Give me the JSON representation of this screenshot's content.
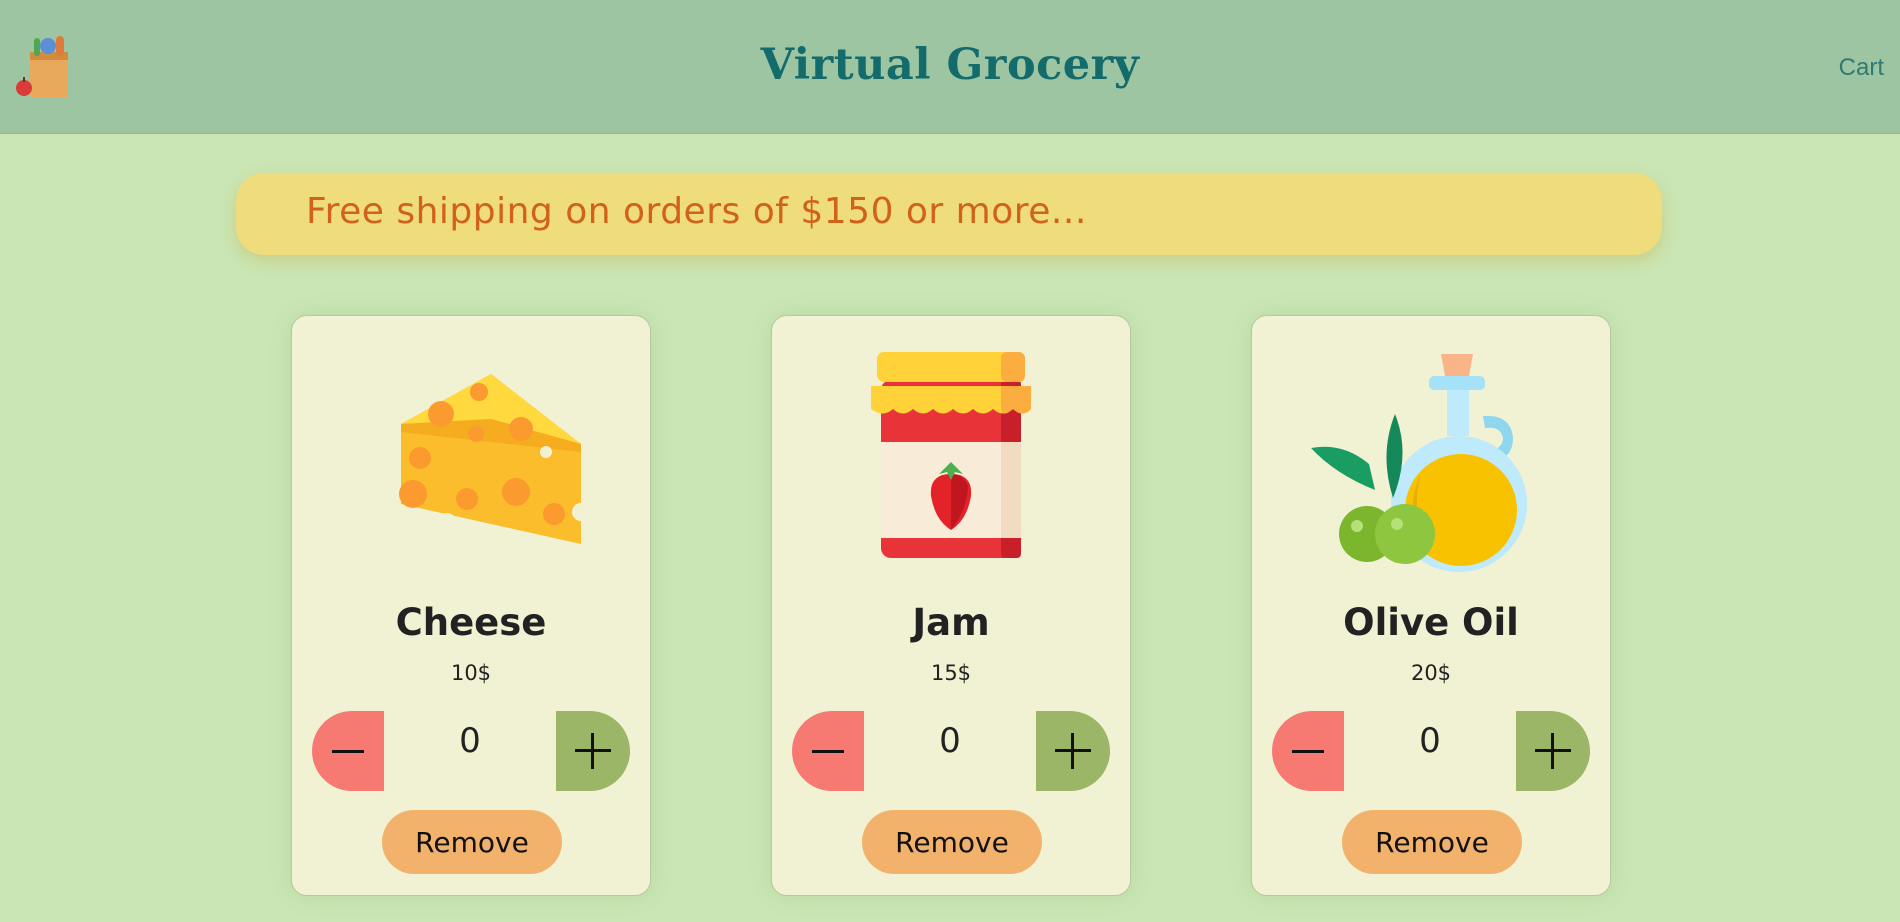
{
  "header": {
    "title": "Virtual Grocery",
    "cart_label": "Cart"
  },
  "banner": {
    "text": "Free shipping on orders of $150 or more..."
  },
  "products": [
    {
      "name": "Cheese",
      "price": "10$",
      "quantity": "0",
      "remove_label": "Remove",
      "icon": "cheese-image"
    },
    {
      "name": "Jam",
      "price": "15$",
      "quantity": "0",
      "remove_label": "Remove",
      "icon": "jam-jar-image"
    },
    {
      "name": "Olive Oil",
      "price": "20$",
      "quantity": "0",
      "remove_label": "Remove",
      "icon": "olive-oil-image"
    }
  ],
  "colors": {
    "header_bg": "#9dc5a2",
    "page_bg": "#cae6b4",
    "title": "#136b6b",
    "banner_bg": "#efdc7d",
    "banner_text": "#d0621a",
    "minus_button": "#f67a72",
    "plus_button": "#9ab666",
    "remove_button": "#f2b26c"
  }
}
